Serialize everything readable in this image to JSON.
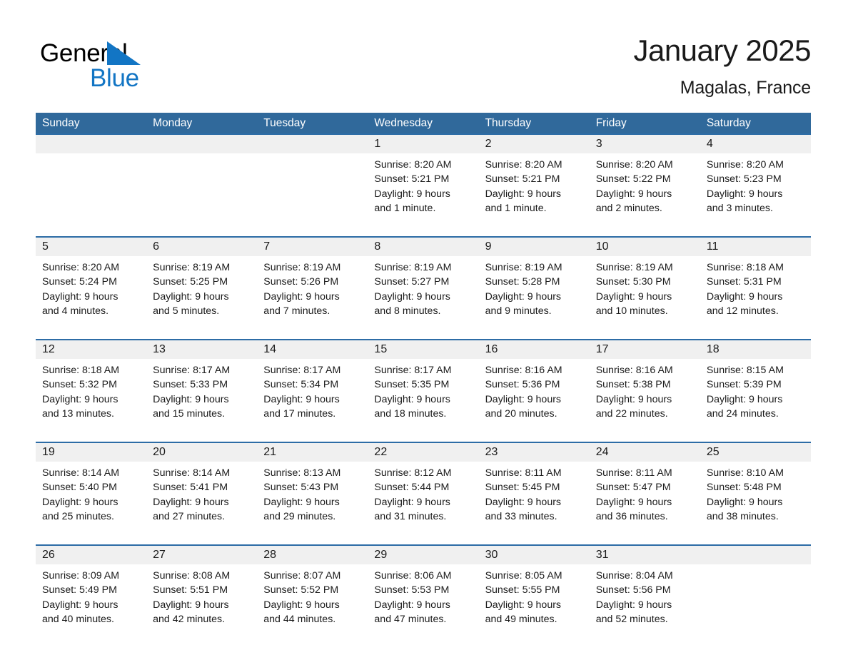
{
  "brand": {
    "name_line1": "General",
    "name_line2": "Blue",
    "triangle_color": "#1275c4",
    "text_color": "#000000"
  },
  "header": {
    "title": "January 2025",
    "location": "Magalas, France"
  },
  "theme": {
    "header_blue": "#30699b",
    "row_divider_blue": "#2d6ca6",
    "daynum_band": "#f0f0f0",
    "text": "#1a1a1a"
  },
  "weekday_headers": [
    "Sunday",
    "Monday",
    "Tuesday",
    "Wednesday",
    "Thursday",
    "Friday",
    "Saturday"
  ],
  "weeks": [
    {
      "days": [
        {
          "num": "",
          "sunrise": "",
          "sunset": "",
          "daylight_1": "",
          "daylight_2": ""
        },
        {
          "num": "",
          "sunrise": "",
          "sunset": "",
          "daylight_1": "",
          "daylight_2": ""
        },
        {
          "num": "",
          "sunrise": "",
          "sunset": "",
          "daylight_1": "",
          "daylight_2": ""
        },
        {
          "num": "1",
          "sunrise": "Sunrise: 8:20 AM",
          "sunset": "Sunset: 5:21 PM",
          "daylight_1": "Daylight: 9 hours",
          "daylight_2": "and 1 minute."
        },
        {
          "num": "2",
          "sunrise": "Sunrise: 8:20 AM",
          "sunset": "Sunset: 5:21 PM",
          "daylight_1": "Daylight: 9 hours",
          "daylight_2": "and 1 minute."
        },
        {
          "num": "3",
          "sunrise": "Sunrise: 8:20 AM",
          "sunset": "Sunset: 5:22 PM",
          "daylight_1": "Daylight: 9 hours",
          "daylight_2": "and 2 minutes."
        },
        {
          "num": "4",
          "sunrise": "Sunrise: 8:20 AM",
          "sunset": "Sunset: 5:23 PM",
          "daylight_1": "Daylight: 9 hours",
          "daylight_2": "and 3 minutes."
        }
      ]
    },
    {
      "days": [
        {
          "num": "5",
          "sunrise": "Sunrise: 8:20 AM",
          "sunset": "Sunset: 5:24 PM",
          "daylight_1": "Daylight: 9 hours",
          "daylight_2": "and 4 minutes."
        },
        {
          "num": "6",
          "sunrise": "Sunrise: 8:19 AM",
          "sunset": "Sunset: 5:25 PM",
          "daylight_1": "Daylight: 9 hours",
          "daylight_2": "and 5 minutes."
        },
        {
          "num": "7",
          "sunrise": "Sunrise: 8:19 AM",
          "sunset": "Sunset: 5:26 PM",
          "daylight_1": "Daylight: 9 hours",
          "daylight_2": "and 7 minutes."
        },
        {
          "num": "8",
          "sunrise": "Sunrise: 8:19 AM",
          "sunset": "Sunset: 5:27 PM",
          "daylight_1": "Daylight: 9 hours",
          "daylight_2": "and 8 minutes."
        },
        {
          "num": "9",
          "sunrise": "Sunrise: 8:19 AM",
          "sunset": "Sunset: 5:28 PM",
          "daylight_1": "Daylight: 9 hours",
          "daylight_2": "and 9 minutes."
        },
        {
          "num": "10",
          "sunrise": "Sunrise: 8:19 AM",
          "sunset": "Sunset: 5:30 PM",
          "daylight_1": "Daylight: 9 hours",
          "daylight_2": "and 10 minutes."
        },
        {
          "num": "11",
          "sunrise": "Sunrise: 8:18 AM",
          "sunset": "Sunset: 5:31 PM",
          "daylight_1": "Daylight: 9 hours",
          "daylight_2": "and 12 minutes."
        }
      ]
    },
    {
      "days": [
        {
          "num": "12",
          "sunrise": "Sunrise: 8:18 AM",
          "sunset": "Sunset: 5:32 PM",
          "daylight_1": "Daylight: 9 hours",
          "daylight_2": "and 13 minutes."
        },
        {
          "num": "13",
          "sunrise": "Sunrise: 8:17 AM",
          "sunset": "Sunset: 5:33 PM",
          "daylight_1": "Daylight: 9 hours",
          "daylight_2": "and 15 minutes."
        },
        {
          "num": "14",
          "sunrise": "Sunrise: 8:17 AM",
          "sunset": "Sunset: 5:34 PM",
          "daylight_1": "Daylight: 9 hours",
          "daylight_2": "and 17 minutes."
        },
        {
          "num": "15",
          "sunrise": "Sunrise: 8:17 AM",
          "sunset": "Sunset: 5:35 PM",
          "daylight_1": "Daylight: 9 hours",
          "daylight_2": "and 18 minutes."
        },
        {
          "num": "16",
          "sunrise": "Sunrise: 8:16 AM",
          "sunset": "Sunset: 5:36 PM",
          "daylight_1": "Daylight: 9 hours",
          "daylight_2": "and 20 minutes."
        },
        {
          "num": "17",
          "sunrise": "Sunrise: 8:16 AM",
          "sunset": "Sunset: 5:38 PM",
          "daylight_1": "Daylight: 9 hours",
          "daylight_2": "and 22 minutes."
        },
        {
          "num": "18",
          "sunrise": "Sunrise: 8:15 AM",
          "sunset": "Sunset: 5:39 PM",
          "daylight_1": "Daylight: 9 hours",
          "daylight_2": "and 24 minutes."
        }
      ]
    },
    {
      "days": [
        {
          "num": "19",
          "sunrise": "Sunrise: 8:14 AM",
          "sunset": "Sunset: 5:40 PM",
          "daylight_1": "Daylight: 9 hours",
          "daylight_2": "and 25 minutes."
        },
        {
          "num": "20",
          "sunrise": "Sunrise: 8:14 AM",
          "sunset": "Sunset: 5:41 PM",
          "daylight_1": "Daylight: 9 hours",
          "daylight_2": "and 27 minutes."
        },
        {
          "num": "21",
          "sunrise": "Sunrise: 8:13 AM",
          "sunset": "Sunset: 5:43 PM",
          "daylight_1": "Daylight: 9 hours",
          "daylight_2": "and 29 minutes."
        },
        {
          "num": "22",
          "sunrise": "Sunrise: 8:12 AM",
          "sunset": "Sunset: 5:44 PM",
          "daylight_1": "Daylight: 9 hours",
          "daylight_2": "and 31 minutes."
        },
        {
          "num": "23",
          "sunrise": "Sunrise: 8:11 AM",
          "sunset": "Sunset: 5:45 PM",
          "daylight_1": "Daylight: 9 hours",
          "daylight_2": "and 33 minutes."
        },
        {
          "num": "24",
          "sunrise": "Sunrise: 8:11 AM",
          "sunset": "Sunset: 5:47 PM",
          "daylight_1": "Daylight: 9 hours",
          "daylight_2": "and 36 minutes."
        },
        {
          "num": "25",
          "sunrise": "Sunrise: 8:10 AM",
          "sunset": "Sunset: 5:48 PM",
          "daylight_1": "Daylight: 9 hours",
          "daylight_2": "and 38 minutes."
        }
      ]
    },
    {
      "days": [
        {
          "num": "26",
          "sunrise": "Sunrise: 8:09 AM",
          "sunset": "Sunset: 5:49 PM",
          "daylight_1": "Daylight: 9 hours",
          "daylight_2": "and 40 minutes."
        },
        {
          "num": "27",
          "sunrise": "Sunrise: 8:08 AM",
          "sunset": "Sunset: 5:51 PM",
          "daylight_1": "Daylight: 9 hours",
          "daylight_2": "and 42 minutes."
        },
        {
          "num": "28",
          "sunrise": "Sunrise: 8:07 AM",
          "sunset": "Sunset: 5:52 PM",
          "daylight_1": "Daylight: 9 hours",
          "daylight_2": "and 44 minutes."
        },
        {
          "num": "29",
          "sunrise": "Sunrise: 8:06 AM",
          "sunset": "Sunset: 5:53 PM",
          "daylight_1": "Daylight: 9 hours",
          "daylight_2": "and 47 minutes."
        },
        {
          "num": "30",
          "sunrise": "Sunrise: 8:05 AM",
          "sunset": "Sunset: 5:55 PM",
          "daylight_1": "Daylight: 9 hours",
          "daylight_2": "and 49 minutes."
        },
        {
          "num": "31",
          "sunrise": "Sunrise: 8:04 AM",
          "sunset": "Sunset: 5:56 PM",
          "daylight_1": "Daylight: 9 hours",
          "daylight_2": "and 52 minutes."
        },
        {
          "num": "",
          "sunrise": "",
          "sunset": "",
          "daylight_1": "",
          "daylight_2": ""
        }
      ]
    }
  ]
}
